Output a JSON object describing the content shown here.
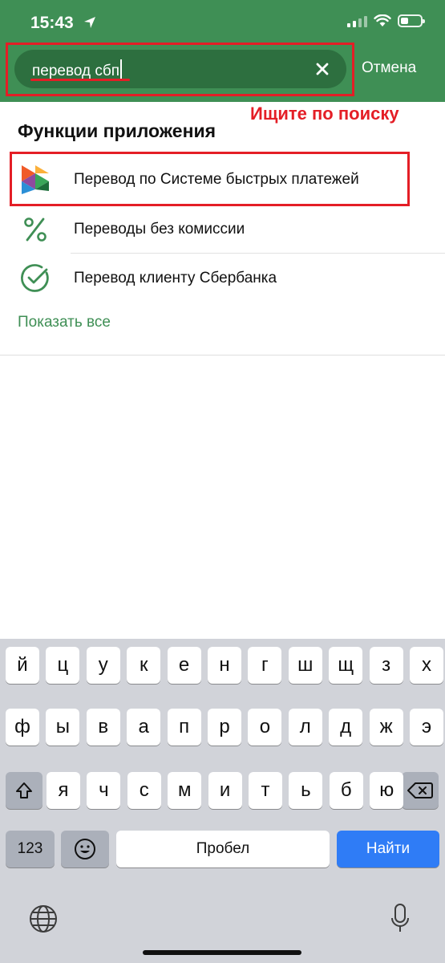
{
  "status_bar": {
    "time": "15:43"
  },
  "search": {
    "query": "перевод сбп",
    "cancel_label": "Отмена"
  },
  "annotation": {
    "hint": "Ищите по поиску"
  },
  "section": {
    "title": "Функции приложения",
    "items": [
      {
        "label": "Перевод по Системе быстрых платежей",
        "icon": "sbp-logo-icon"
      },
      {
        "label": "Переводы без комиссии",
        "icon": "percent-icon"
      },
      {
        "label": "Перевод клиенту Сбербанка",
        "icon": "sber-check-icon"
      }
    ],
    "show_all": "Показать все"
  },
  "keyboard": {
    "row1": [
      "й",
      "ц",
      "у",
      "к",
      "е",
      "н",
      "г",
      "ш",
      "щ",
      "з",
      "х"
    ],
    "row2": [
      "ф",
      "ы",
      "в",
      "а",
      "п",
      "р",
      "о",
      "л",
      "д",
      "ж",
      "э"
    ],
    "row3": [
      "я",
      "ч",
      "с",
      "м",
      "и",
      "т",
      "ь",
      "б",
      "ю"
    ],
    "numbers_label": "123",
    "space_label": "Пробел",
    "go_label": "Найти"
  },
  "colors": {
    "header_green": "#3f8f55",
    "search_green": "#2d6f3f",
    "annotation_red": "#e41e26",
    "link_green": "#3f8f55",
    "go_blue": "#2f7cf6"
  }
}
